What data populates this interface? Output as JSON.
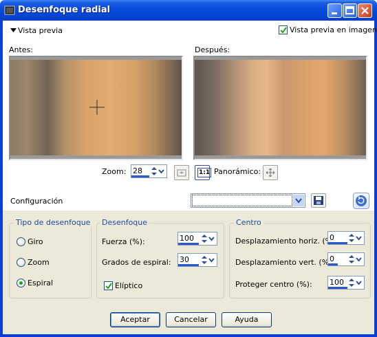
{
  "window": {
    "title": "Desenfoque radial"
  },
  "preview": {
    "toggle_label": "Vista previa",
    "in_image_label": "Vista previa en imagen",
    "in_image_checked": true,
    "before_label": "Antes:",
    "after_label": "Después:",
    "zoom_label": "Zoom:",
    "zoom_value": "28",
    "one_to_one_label": "1:1",
    "pan_label": "Panorámico:"
  },
  "config": {
    "label": "Configuración",
    "preset_value": ""
  },
  "blur_type": {
    "legend": "Tipo de desenfoque",
    "options": [
      {
        "label": "Giro",
        "selected": false
      },
      {
        "label": "Zoom",
        "selected": false
      },
      {
        "label": "Espiral",
        "selected": true
      }
    ]
  },
  "blur": {
    "legend": "Desenfoque",
    "strength_label": "Fuerza (%):",
    "strength_value": "100",
    "spiral_label": "Grados de espiral:",
    "spiral_value": "30",
    "elliptic_label": "Elíptico",
    "elliptic_checked": true
  },
  "center": {
    "legend": "Centro",
    "horiz_label": "Desplazamiento horiz. (%):",
    "horiz_value": "0",
    "vert_label": "Desplazamiento vert. (%):",
    "vert_value": "0",
    "protect_label": "Proteger centro (%):",
    "protect_value": "100"
  },
  "buttons": {
    "ok": "Aceptar",
    "cancel": "Cancelar",
    "help": "Ayuda"
  },
  "colors": {
    "title_bar": "#0a4bdd",
    "dialog_bg": "#ece9d8",
    "group_legend": "#1a4ba8",
    "image_tan": "#d9a468"
  }
}
